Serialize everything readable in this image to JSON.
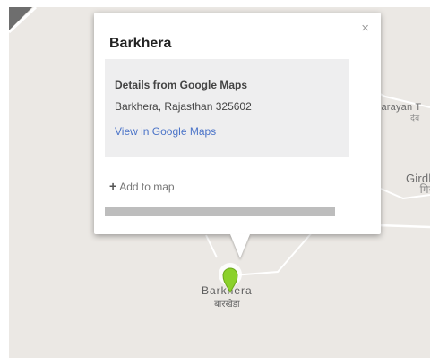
{
  "info_window": {
    "title": "Barkhera",
    "close_glyph": "×",
    "details": {
      "heading": "Details from Google Maps",
      "address": "Barkhera, Rajasthan 325602",
      "link": "View in Google Maps"
    },
    "add_to_map": "Add to map",
    "add_icon": "plus-icon"
  },
  "map": {
    "places": [
      {
        "name": "Devnarayan T",
        "sub": "देव"
      },
      {
        "name": "Girdh",
        "sub": "गिर्"
      }
    ],
    "marker": {
      "label": "Barkhera",
      "label_sub": "बारखेड़ा",
      "icon": "map-pin-icon",
      "color": "#8bd12b"
    },
    "colors": {
      "land": "#ebe8e4",
      "road": "#ffffff"
    }
  }
}
